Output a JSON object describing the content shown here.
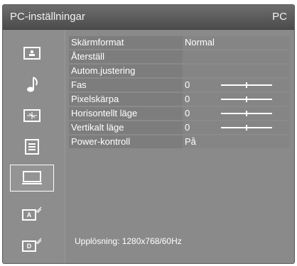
{
  "window": {
    "title": "PC-inställningar",
    "source": "PC"
  },
  "sidebar": {
    "items": [
      {
        "icon": "picture-icon"
      },
      {
        "icon": "sound-icon"
      },
      {
        "icon": "features-icon"
      },
      {
        "icon": "setup-icon"
      },
      {
        "icon": "pc-monitor-icon",
        "selected": true
      },
      {
        "icon": "analog-channel-icon",
        "label": "A"
      },
      {
        "icon": "digital-channel-icon",
        "label": "D"
      }
    ]
  },
  "menu": {
    "rows": [
      {
        "label": "Skärmformat",
        "value": "Normal"
      },
      {
        "label": "Återställ",
        "value": ""
      },
      {
        "label": "Autom.justering",
        "value": ""
      },
      {
        "label": "Fas",
        "value": "0",
        "slider": 0.5
      },
      {
        "label": "Pixelskärpa",
        "value": "0",
        "slider": 0.5
      },
      {
        "label": "Horisontellt läge",
        "value": "0",
        "slider": 0.5
      },
      {
        "label": "Vertikalt läge",
        "value": "0",
        "slider": 0.5
      },
      {
        "label": "Power-kontroll",
        "value": "På"
      }
    ]
  },
  "footer": {
    "resolution": "Upplösning: 1280x768/60Hz"
  },
  "colors": {
    "background": "#8a8a8a",
    "titlebar": "#555555",
    "text": "#ffffff"
  }
}
